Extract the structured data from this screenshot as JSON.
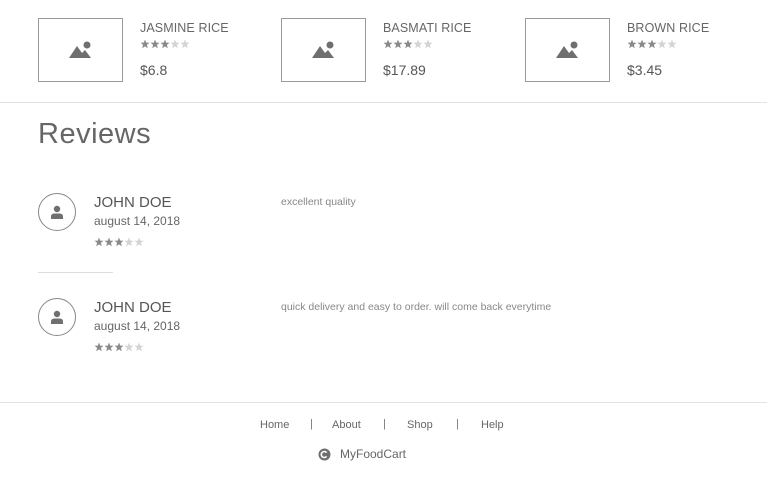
{
  "products": [
    {
      "name": "JASMINE RICE",
      "price": "$6.8",
      "rating": 3,
      "max_rating": 5
    },
    {
      "name": "BASMATI RICE",
      "price": "$17.89",
      "rating": 3,
      "max_rating": 5
    },
    {
      "name": "BROWN RICE",
      "price": "$3.45",
      "rating": 3,
      "max_rating": 5
    }
  ],
  "reviews": {
    "title": "Reviews",
    "items": [
      {
        "name": "JOHN DOE",
        "date": "august 14, 2018",
        "rating": 3,
        "max_rating": 5,
        "comment": "excellent quality"
      },
      {
        "name": "JOHN DOE",
        "date": "august 14, 2018",
        "rating": 3,
        "max_rating": 5,
        "comment": "quick delivery and easy to order. will come back everytime"
      }
    ]
  },
  "footer": {
    "links": [
      "Home",
      "About",
      "Shop",
      "Help"
    ],
    "separator": "|",
    "brand": "MyFoodCart"
  },
  "colors": {
    "star_filled": "#8a8a8a",
    "star_empty": "#d4d4d4",
    "icon": "#6f6f6f"
  },
  "icons": {
    "product_placeholder": "image-icon",
    "reviewer": "user-icon",
    "brand": "copyright-icon",
    "rating": "star-icon"
  }
}
